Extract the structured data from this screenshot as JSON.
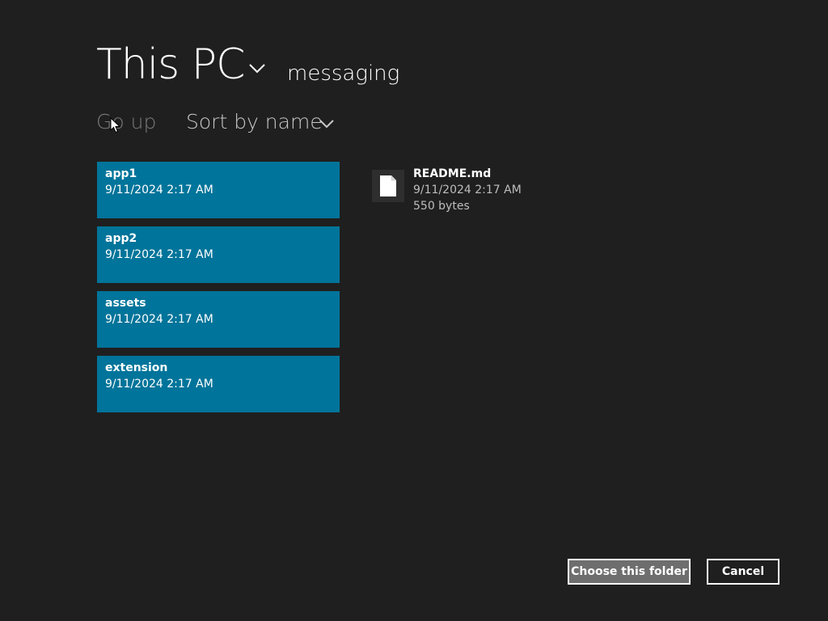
{
  "header": {
    "location_title": "This PC",
    "current_folder": "messaging"
  },
  "toolbar": {
    "go_up_label": "Go up",
    "sort_label": "Sort by name"
  },
  "folders": [
    {
      "name": "app1",
      "modified": "9/11/2024 2:17 AM"
    },
    {
      "name": "app2",
      "modified": "9/11/2024 2:17 AM"
    },
    {
      "name": "assets",
      "modified": "9/11/2024 2:17 AM"
    },
    {
      "name": "extension",
      "modified": "9/11/2024 2:17 AM"
    }
  ],
  "files": [
    {
      "name": "README.md",
      "modified": "9/11/2024 2:17 AM",
      "size": "550 bytes",
      "icon": "document-icon"
    }
  ],
  "actions": {
    "choose_label": "Choose this folder",
    "cancel_label": "Cancel"
  },
  "colors": {
    "background": "#1f1f1f",
    "folder_tile": "#00749a",
    "primary_button": "#6e6e6e"
  }
}
